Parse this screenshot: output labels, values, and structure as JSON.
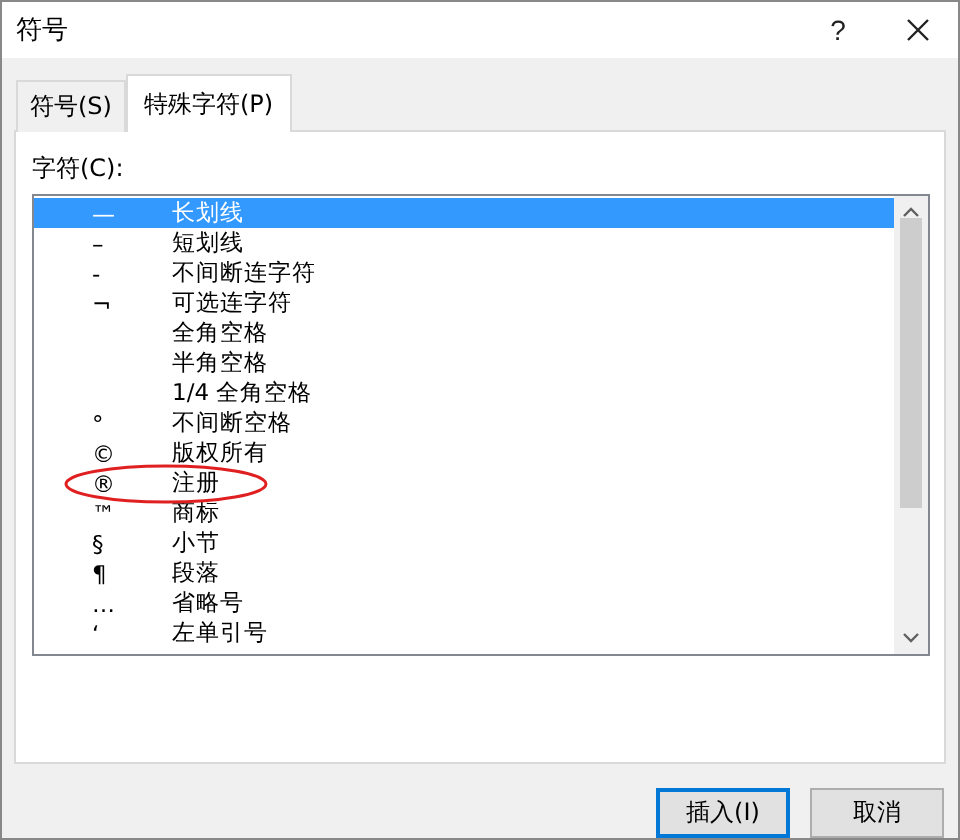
{
  "window": {
    "title": "符号",
    "help": "?"
  },
  "tabs": [
    {
      "label": "符号(S)",
      "selected": false
    },
    {
      "label": "特殊字符(P)",
      "selected": true
    }
  ],
  "list_label": "字符(C):",
  "characters": [
    {
      "symbol": "—",
      "name": "长划线",
      "selected": true
    },
    {
      "symbol": "–",
      "name": "短划线",
      "selected": false
    },
    {
      "symbol": "-",
      "name": "不间断连字符",
      "selected": false
    },
    {
      "symbol": "¬",
      "name": "可选连字符",
      "selected": false
    },
    {
      "name": "全角空格",
      "selected": false
    },
    {
      "name": "半角空格",
      "selected": false
    },
    {
      "name": "1/4 全角空格",
      "selected": false
    },
    {
      "symbol": "°",
      "name": "不间断空格",
      "selected": false
    },
    {
      "symbol": "©",
      "name": "版权所有",
      "selected": false
    },
    {
      "symbol": "®",
      "name": "注册",
      "selected": false,
      "circled": true
    },
    {
      "symbol": "™",
      "name": "商标",
      "selected": false
    },
    {
      "symbol": "§",
      "name": "小节",
      "selected": false
    },
    {
      "symbol": "¶",
      "name": "段落",
      "selected": false
    },
    {
      "symbol": "…",
      "name": "省略号",
      "selected": false
    },
    {
      "symbol": "‘",
      "name": "左单引号",
      "selected": false
    }
  ],
  "buttons": [
    {
      "label": "插入(I)",
      "default": true
    },
    {
      "label": "取消",
      "default": false
    }
  ]
}
